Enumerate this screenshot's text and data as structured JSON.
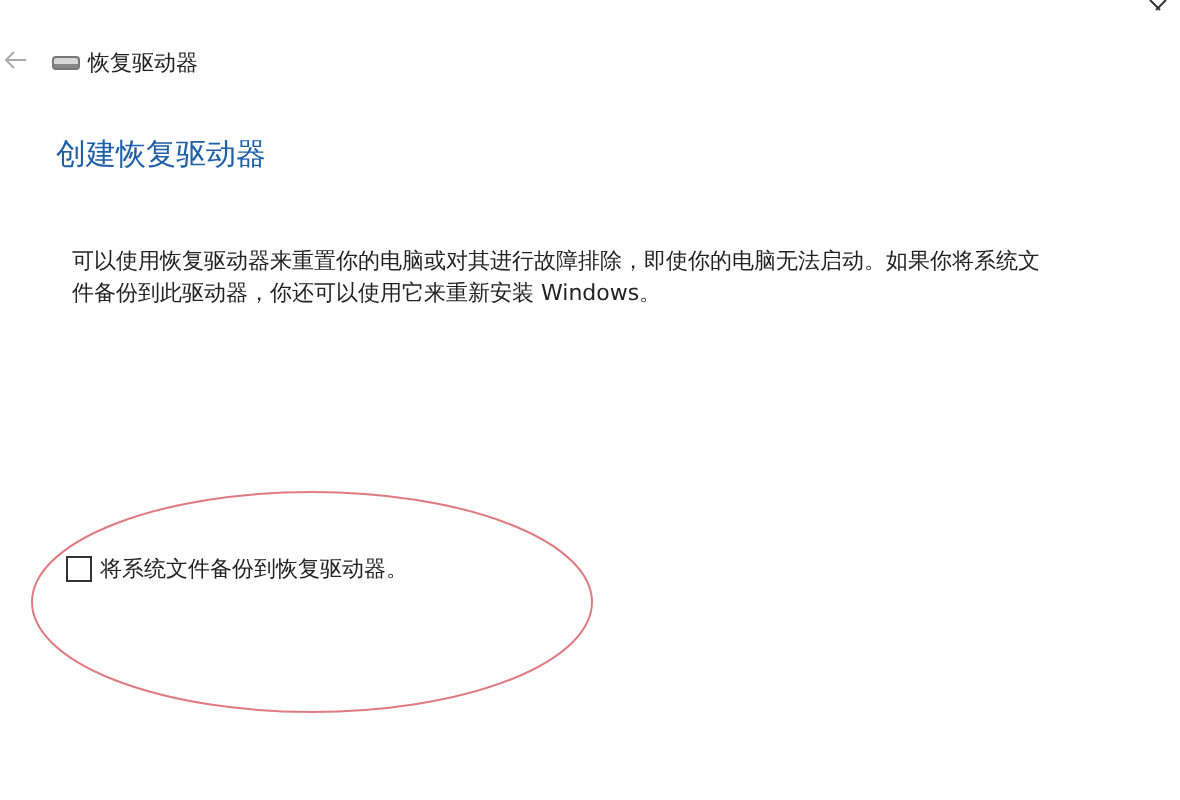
{
  "window": {
    "title": "恢复驱动器"
  },
  "heading": "创建恢复驱动器",
  "description": "可以使用恢复驱动器来重置你的电脑或对其进行故障排除，即使你的电脑无法启动。如果你将系统文件备份到此驱动器，你还可以使用它来重新安装 Windows。",
  "options": [
    {
      "label": "将系统文件备份到恢复驱动器。",
      "checked": false
    }
  ],
  "annotation": {
    "kind": "ellipse",
    "color": "#e07a80"
  }
}
